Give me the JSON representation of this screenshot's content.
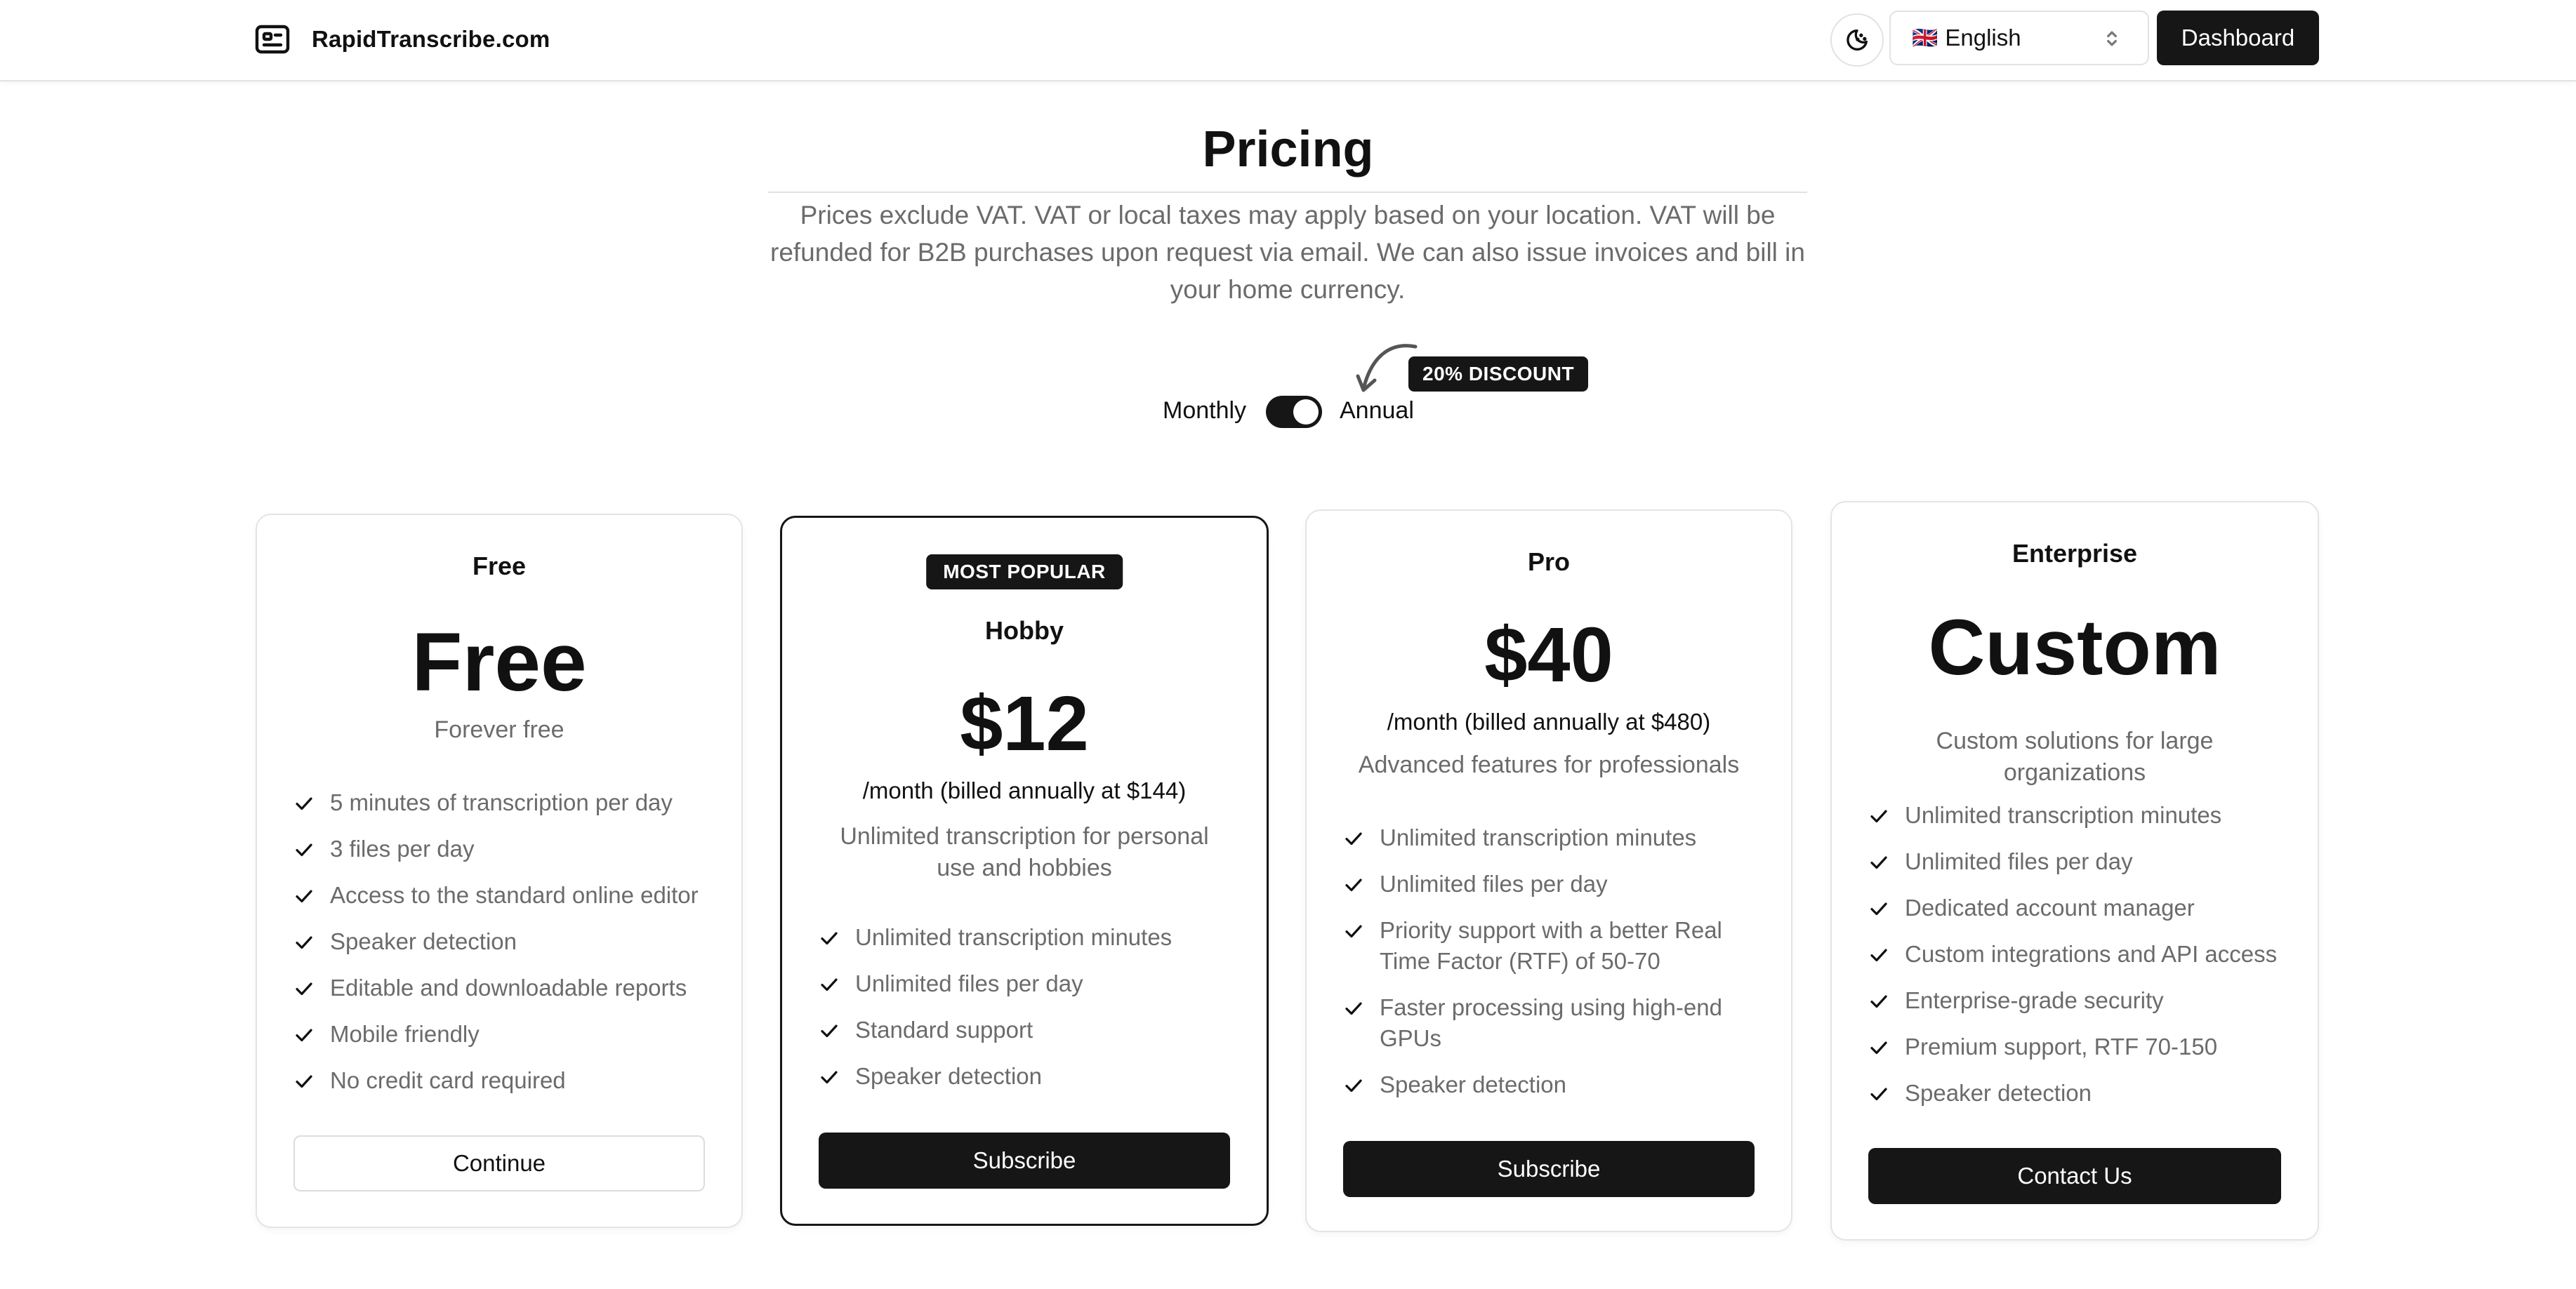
{
  "header": {
    "brand": "RapidTranscribe.com",
    "brand_icon": "scanner-icon",
    "theme_icon": "moon-stars-icon",
    "language": {
      "flag": "🇬🇧",
      "label": "English"
    },
    "dashboard_label": "Dashboard"
  },
  "hero": {
    "title": "Pricing",
    "subtitle": "Prices exclude VAT. VAT or local taxes may apply based on your location. VAT will be refunded for B2B purchases upon request via email. We can also issue invoices and bill in your home currency."
  },
  "billing": {
    "monthly_label": "Monthly",
    "annual_label": "Annual",
    "annual_selected": true,
    "discount_badge": "20% DISCOUNT"
  },
  "plans": [
    {
      "name": "Free",
      "price": "Free",
      "price_note": "",
      "description": "Forever free",
      "features": [
        "5 minutes of transcription per day",
        "3 files per day",
        "Access to the standard online editor",
        "Speaker detection",
        "Editable and downloadable reports",
        "Mobile friendly",
        "No credit card required"
      ],
      "cta": "Continue"
    },
    {
      "badge": "MOST POPULAR",
      "name": "Hobby",
      "price": "$12",
      "price_note": "/month (billed annually at $144)",
      "description": "Unlimited transcription for personal use and hobbies",
      "features": [
        "Unlimited transcription minutes",
        "Unlimited files per day",
        "Standard support",
        "Speaker detection"
      ],
      "cta": "Subscribe"
    },
    {
      "name": "Pro",
      "price": "$40",
      "price_note": "/month (billed annually at $480)",
      "description": "Advanced features for professionals",
      "features": [
        "Unlimited transcription minutes",
        "Unlimited files per day",
        "Priority support with a better Real Time Factor (RTF) of 50-70",
        "Faster processing using high-end GPUs",
        "Speaker detection"
      ],
      "cta": "Subscribe"
    },
    {
      "name": "Enterprise",
      "price": "Custom",
      "price_note": "",
      "description": "Custom solutions for large organizations",
      "features": [
        "Unlimited transcription minutes",
        "Unlimited files per day",
        "Dedicated account manager",
        "Custom integrations and API access",
        "Enterprise-grade security",
        "Premium support, RTF 70-150",
        "Speaker detection"
      ],
      "cta": "Contact Us"
    }
  ],
  "colors": {
    "primary": "#161616",
    "muted_text": "#6b6b6b",
    "border": "#e4e4e4"
  }
}
